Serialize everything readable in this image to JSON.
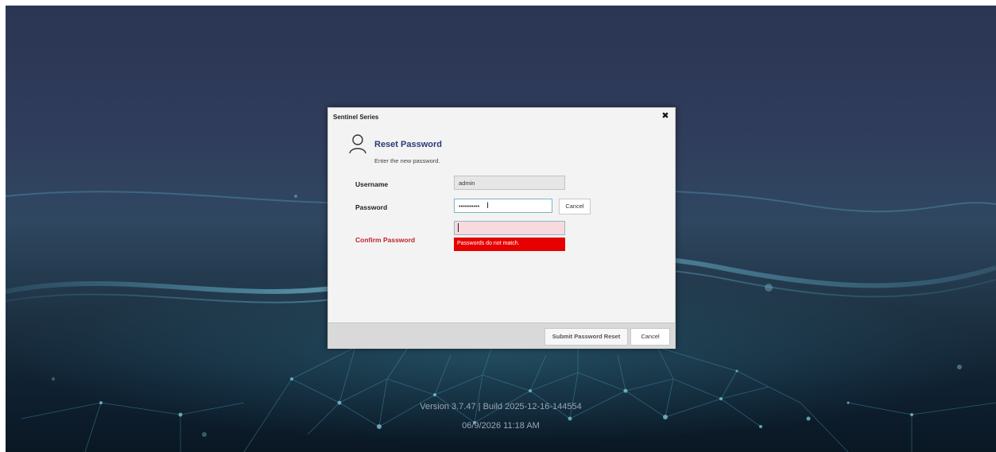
{
  "dialog": {
    "title": "Sentinel Series",
    "close_glyph": "✖",
    "heading": "Reset Password",
    "subheading": "Enter the new password.",
    "icon": "user-icon"
  },
  "form": {
    "username_label": "Username",
    "username_value": "admin",
    "password_label": "Password",
    "password_value": "••••••••••",
    "password_cancel_label": "Cancel",
    "confirm_label": "Confirm Password",
    "confirm_value": "",
    "error_message": "Passwords do not match."
  },
  "footer_buttons": {
    "submit_label": "Submit Password Reset",
    "cancel_label": "Cancel"
  },
  "screen_footer": {
    "version": "Version 3.7.47 | Build 2025-12-16-144554",
    "datetime": "06/9/2026 11:18 AM"
  },
  "colors": {
    "heading": "#2b3a7a",
    "error_label": "#c0242b",
    "error_banner": "#e60000",
    "confirm_field_bg": "#f8d9dd"
  }
}
